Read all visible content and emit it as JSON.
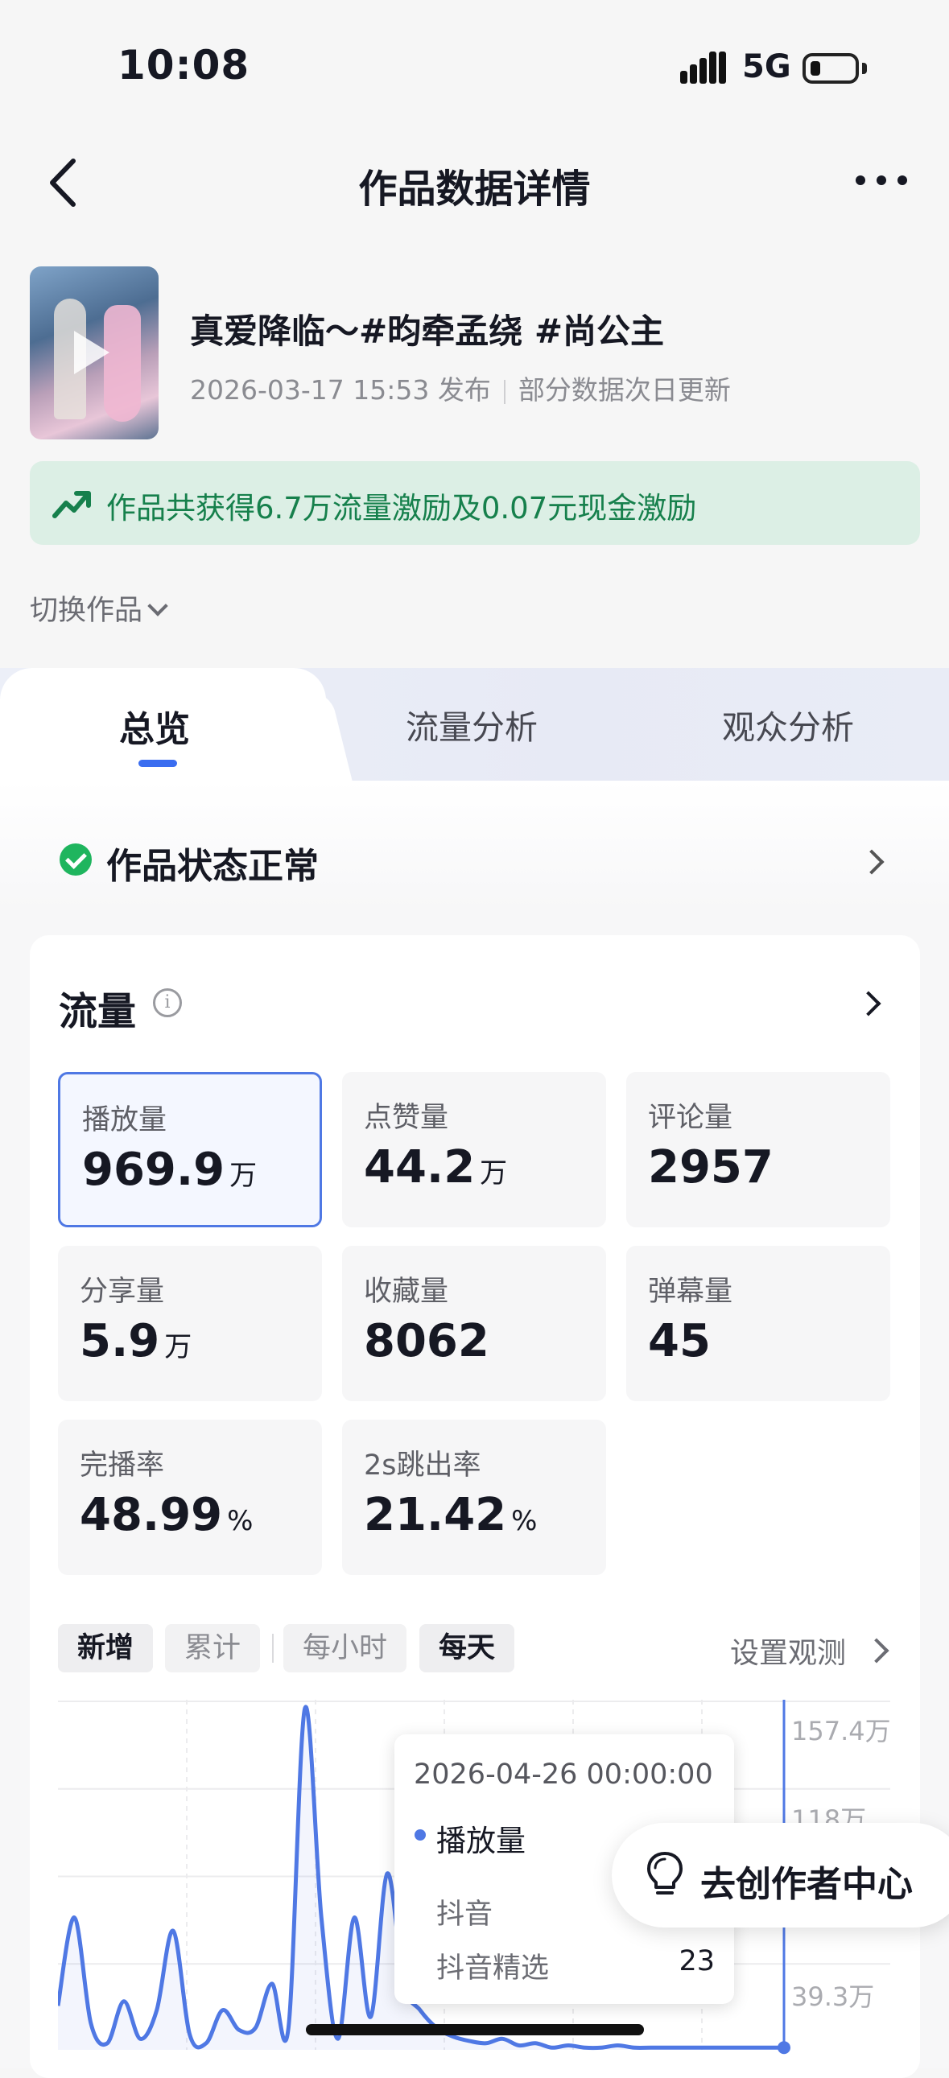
{
  "status_bar": {
    "time": "10:08",
    "network": "5G",
    "icons": [
      "signal-icon",
      "battery-icon"
    ]
  },
  "nav": {
    "title": "作品数据详情",
    "back_icon": "back-chevron-icon",
    "more_icon": "more-dots-icon"
  },
  "work": {
    "title": "真爱降临～#昀牵孟绕 #尚公主",
    "publish_time": "2026-03-17 15:53 发布",
    "update_note": "部分数据次日更新",
    "incentive_text": "作品共获得6.7万流量激励及0.07元现金激励",
    "switch_label": "切换作品"
  },
  "tabs": [
    {
      "label": "总览",
      "active": true
    },
    {
      "label": "流量分析"
    },
    {
      "label": "观众分析"
    }
  ],
  "status": {
    "label": "作品状态正常"
  },
  "flow": {
    "title": "流量",
    "metrics": [
      {
        "label": "播放量",
        "value": "969.9",
        "unit": "万",
        "selected": true
      },
      {
        "label": "点赞量",
        "value": "44.2",
        "unit": "万"
      },
      {
        "label": "评论量",
        "value": "2957",
        "unit": ""
      },
      {
        "label": "分享量",
        "value": "5.9",
        "unit": "万"
      },
      {
        "label": "收藏量",
        "value": "8062",
        "unit": ""
      },
      {
        "label": "弹幕量",
        "value": "45",
        "unit": ""
      },
      {
        "label": "完播率",
        "value": "48.99",
        "unit": "%"
      },
      {
        "label": "2s跳出率",
        "value": "21.42",
        "unit": "%"
      }
    ],
    "chips": [
      {
        "label": "新增",
        "on": true
      },
      {
        "label": "累计",
        "on": false
      },
      {
        "label": "每小时",
        "on": false
      },
      {
        "label": "每天",
        "on": true
      }
    ],
    "observe_label": "设置观测"
  },
  "chart_data": {
    "type": "line",
    "y_tick_labels": [
      "157.4万",
      "118万",
      "39.3万"
    ],
    "ylim": [
      0,
      157.4
    ],
    "y_unit": "万",
    "x": [
      0,
      1,
      2,
      3,
      4,
      5,
      6,
      7,
      8,
      9,
      10,
      11,
      12,
      13,
      14,
      15,
      16,
      17,
      18,
      19,
      20,
      21,
      22,
      23,
      24,
      25,
      26,
      27,
      28,
      29,
      30,
      31,
      32,
      33,
      34,
      35,
      36,
      37,
      38,
      39,
      40,
      41,
      42,
      43,
      44
    ],
    "series": [
      {
        "name": "播放量",
        "color": "#4f78e4",
        "values": [
          20,
          60,
          12,
          3,
          22,
          5,
          18,
          54,
          7,
          3,
          18,
          9,
          10,
          30,
          10,
          155,
          60,
          5,
          60,
          15,
          80,
          30,
          18,
          10,
          6,
          4,
          3,
          5,
          2,
          3,
          1,
          2,
          1,
          1,
          2,
          1,
          1,
          1,
          1,
          1,
          1,
          1,
          1,
          1,
          1
        ]
      }
    ],
    "tooltip": {
      "date": "2026-04-26 00:00:00",
      "metric": "播放量",
      "rows": [
        {
          "label": "抖音",
          "value": ""
        },
        {
          "label": "抖音精选",
          "value": "23"
        }
      ]
    }
  },
  "floating_button": {
    "label": "去创作者中心",
    "icon": "lightbulb-icon"
  }
}
